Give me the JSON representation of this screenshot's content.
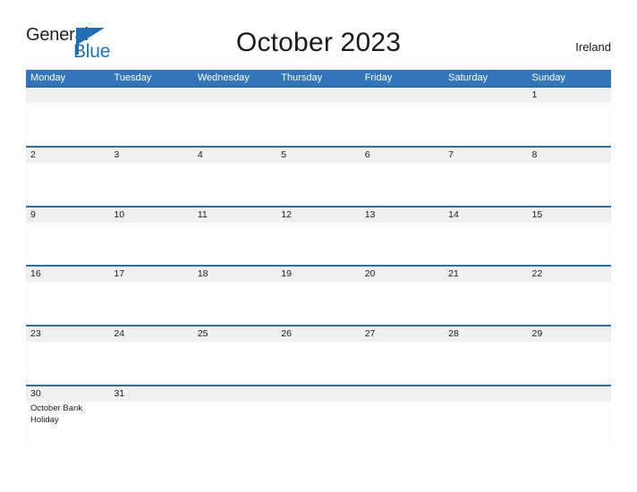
{
  "brand": {
    "name_part1": "General",
    "name_part2": "Blue",
    "color_dark": "#231f20",
    "color_blue": "#1f6fb2"
  },
  "header": {
    "title": "October 2023",
    "country": "Ireland"
  },
  "calendar": {
    "accent_color": "#3275b8",
    "separator_color": "#2e6da4",
    "band_color": "#f0f0f0",
    "day_headers": [
      "Monday",
      "Tuesday",
      "Wednesday",
      "Thursday",
      "Friday",
      "Saturday",
      "Sunday"
    ],
    "weeks": [
      [
        {
          "day": "",
          "event": ""
        },
        {
          "day": "",
          "event": ""
        },
        {
          "day": "",
          "event": ""
        },
        {
          "day": "",
          "event": ""
        },
        {
          "day": "",
          "event": ""
        },
        {
          "day": "",
          "event": ""
        },
        {
          "day": "1",
          "event": ""
        }
      ],
      [
        {
          "day": "2",
          "event": ""
        },
        {
          "day": "3",
          "event": ""
        },
        {
          "day": "4",
          "event": ""
        },
        {
          "day": "5",
          "event": ""
        },
        {
          "day": "6",
          "event": ""
        },
        {
          "day": "7",
          "event": ""
        },
        {
          "day": "8",
          "event": ""
        }
      ],
      [
        {
          "day": "9",
          "event": ""
        },
        {
          "day": "10",
          "event": ""
        },
        {
          "day": "11",
          "event": ""
        },
        {
          "day": "12",
          "event": ""
        },
        {
          "day": "13",
          "event": ""
        },
        {
          "day": "14",
          "event": ""
        },
        {
          "day": "15",
          "event": ""
        }
      ],
      [
        {
          "day": "16",
          "event": ""
        },
        {
          "day": "17",
          "event": ""
        },
        {
          "day": "18",
          "event": ""
        },
        {
          "day": "19",
          "event": ""
        },
        {
          "day": "20",
          "event": ""
        },
        {
          "day": "21",
          "event": ""
        },
        {
          "day": "22",
          "event": ""
        }
      ],
      [
        {
          "day": "23",
          "event": ""
        },
        {
          "day": "24",
          "event": ""
        },
        {
          "day": "25",
          "event": ""
        },
        {
          "day": "26",
          "event": ""
        },
        {
          "day": "27",
          "event": ""
        },
        {
          "day": "28",
          "event": ""
        },
        {
          "day": "29",
          "event": ""
        }
      ],
      [
        {
          "day": "30",
          "event": "October Bank Holiday"
        },
        {
          "day": "31",
          "event": ""
        },
        {
          "day": "",
          "event": ""
        },
        {
          "day": "",
          "event": ""
        },
        {
          "day": "",
          "event": ""
        },
        {
          "day": "",
          "event": ""
        },
        {
          "day": "",
          "event": ""
        }
      ]
    ]
  }
}
